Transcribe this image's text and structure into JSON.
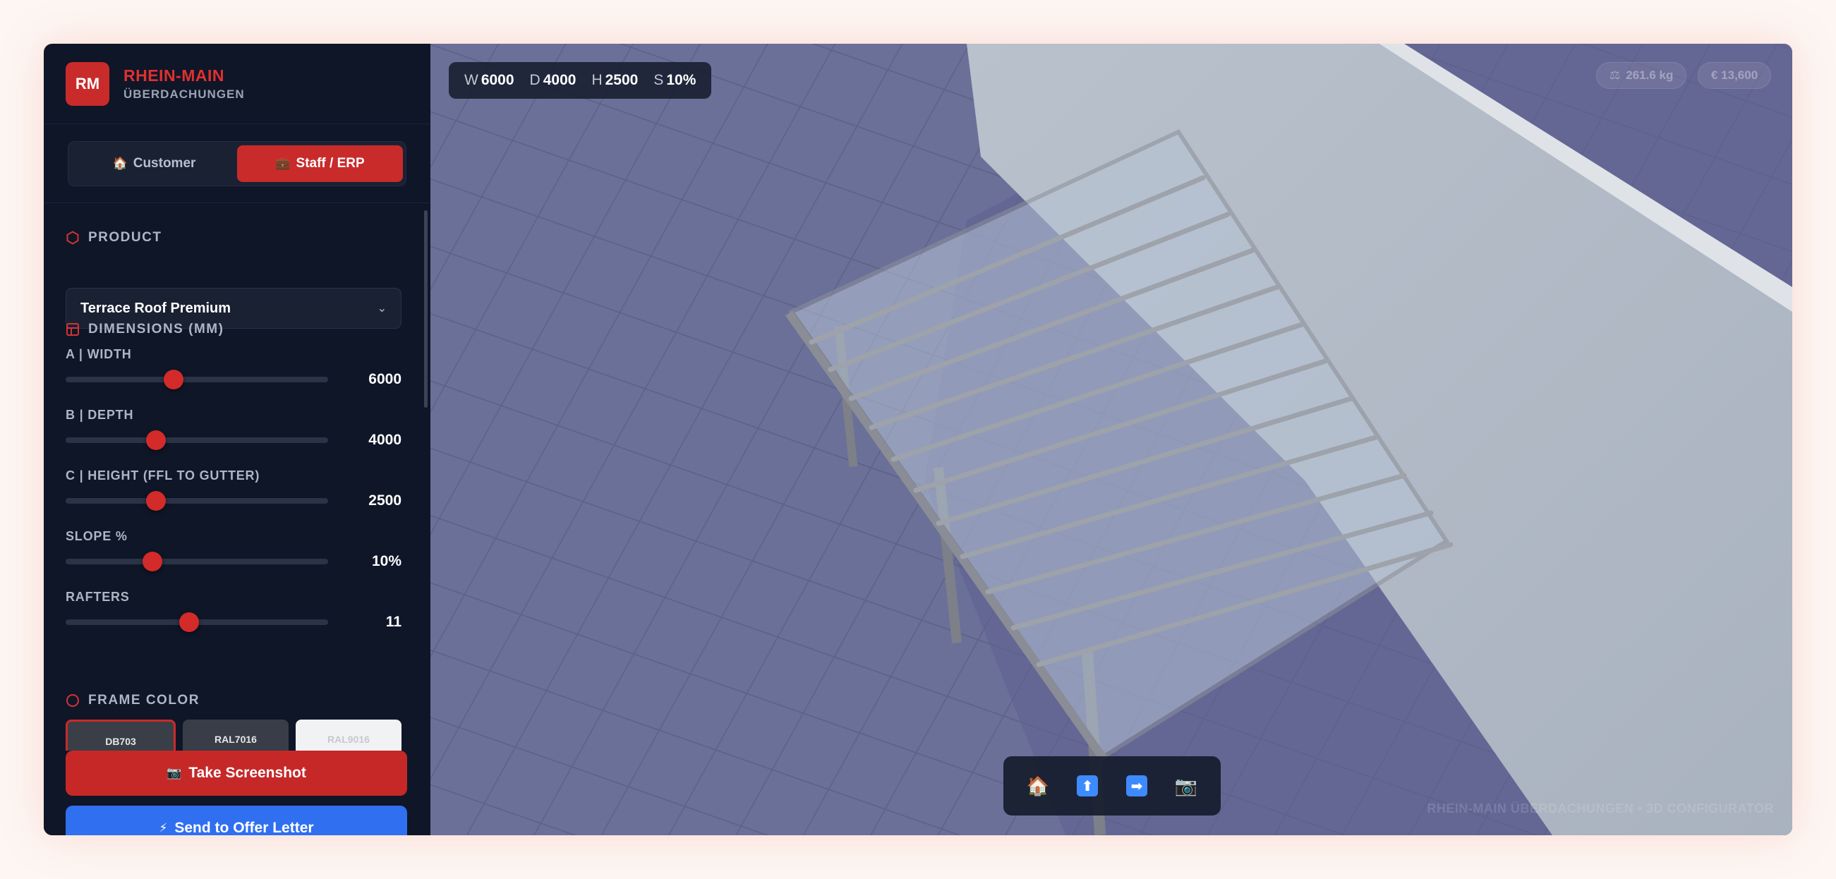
{
  "brand": {
    "logo": "RM",
    "title": "RHEIN-MAIN",
    "subtitle": "ÜBERDACHUNGEN"
  },
  "mode": {
    "customer_icon": "🏠",
    "customer_label": "Customer",
    "staff_icon": "💼",
    "staff_label": "Staff / ERP",
    "active": "Staff / ERP"
  },
  "product": {
    "heading": "PRODUCT",
    "selected": "Terrace Roof Premium"
  },
  "dimensions": {
    "heading": "DIMENSIONS (MM)",
    "sliders": [
      {
        "label": "A | WIDTH",
        "value": "6000",
        "fraction": 0.41
      },
      {
        "label": "B | DEPTH",
        "value": "4000",
        "fraction": 0.345
      },
      {
        "label": "C | HEIGHT (FFL TO GUTTER)",
        "value": "2500",
        "fraction": 0.345
      },
      {
        "label": "SLOPE %",
        "value": "10%",
        "fraction": 0.33
      },
      {
        "label": "RAFTERS",
        "value": "11",
        "fraction": 0.47
      }
    ]
  },
  "frame_color": {
    "heading": "FRAME COLOR",
    "options": [
      "DB703",
      "RAL7016",
      "RAL9016"
    ],
    "selected": "DB703"
  },
  "actions": {
    "screenshot_icon": "📷",
    "screenshot_label": "Take Screenshot",
    "offer_icon": "⚡",
    "offer_label": "Send to Offer Letter"
  },
  "viewport": {
    "dims": {
      "w_key": "W",
      "w_val": "6000",
      "d_key": "D",
      "d_val": "4000",
      "h_key": "H",
      "h_val": "2500",
      "s_key": "S",
      "s_val": "10%"
    },
    "weight_icon": "⚖",
    "weight": "261.6 kg",
    "price": "€ 13,600",
    "view_buttons": {
      "home_icon": "🏠",
      "top_icon": "⬆",
      "side_icon": "➡",
      "camera_icon": "📷"
    },
    "watermark": "RHEIN-MAIN ÜBERDACHUNGEN • 3D CONFIGURATOR"
  },
  "colors": {
    "accent_red": "#c92b2b",
    "accent_blue": "#2f6ff0",
    "sidebar_bg": "#0f1627",
    "viewport_floor": "#6b7099"
  }
}
